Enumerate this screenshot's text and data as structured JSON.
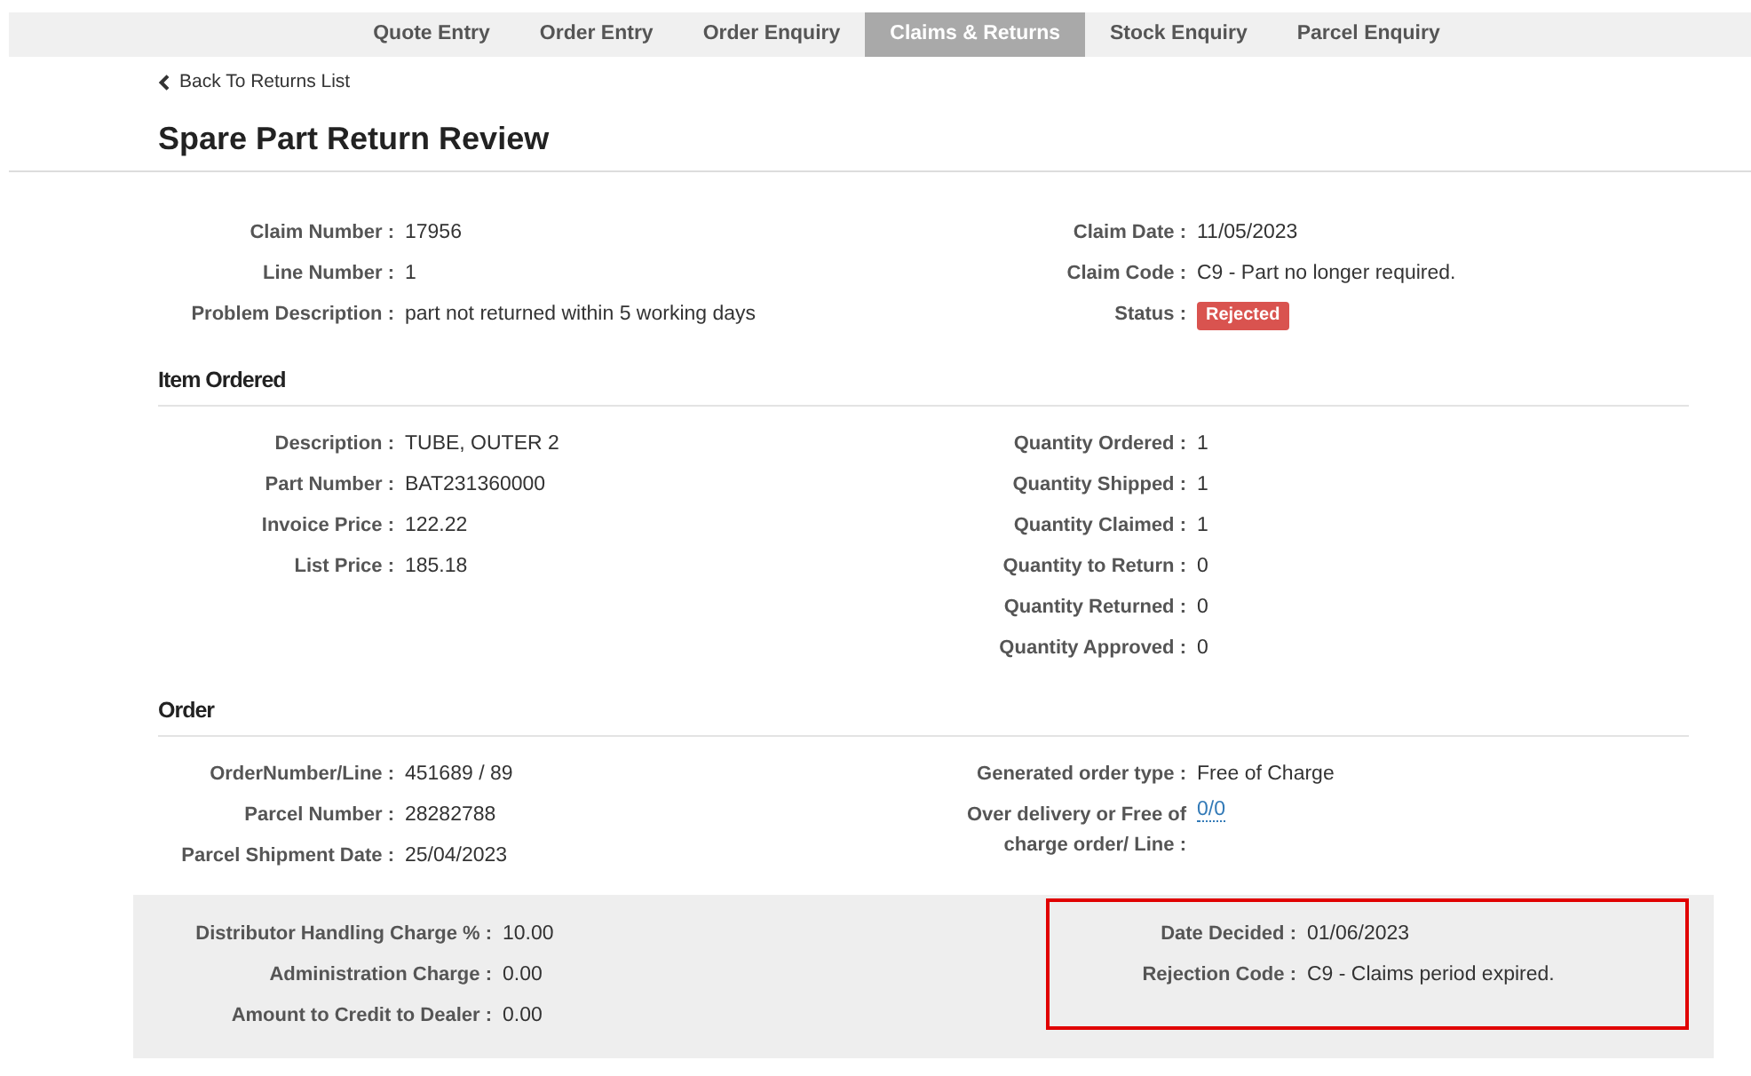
{
  "nav": {
    "tabs": [
      {
        "label": "Quote Entry",
        "selected": false
      },
      {
        "label": "Order Entry",
        "selected": false
      },
      {
        "label": "Order Enquiry",
        "selected": false
      },
      {
        "label": "Claims & Returns",
        "selected": true
      },
      {
        "label": "Stock Enquiry",
        "selected": false
      },
      {
        "label": "Parcel Enquiry",
        "selected": false
      }
    ]
  },
  "back_link": "Back To Returns List",
  "title": "Spare Part Return Review",
  "summary": {
    "left": [
      {
        "label": "Claim Number :",
        "value": "17956",
        "kind": "text"
      },
      {
        "label": "Line Number :",
        "value": "1",
        "kind": "text"
      },
      {
        "label": "Problem Description :",
        "value": "part not returned within 5 working days",
        "kind": "text"
      }
    ],
    "right": [
      {
        "label": "Claim Date :",
        "value": "11/05/2023",
        "kind": "text"
      },
      {
        "label": "Claim Code :",
        "value": "C9 - Part no longer required.",
        "kind": "text"
      },
      {
        "label": "Status :",
        "value": "Rejected",
        "kind": "badge",
        "color": "#d9534f"
      }
    ]
  },
  "sections": [
    {
      "title": "Item Ordered",
      "left": [
        {
          "label": "Description :",
          "value": "TUBE, OUTER 2",
          "kind": "text"
        },
        {
          "label": "Part Number :",
          "value": "BAT231360000",
          "kind": "text"
        },
        {
          "label": "Invoice Price :",
          "value": "122.22",
          "kind": "text"
        },
        {
          "label": "List Price :",
          "value": "185.18",
          "kind": "text"
        }
      ],
      "right": [
        {
          "label": "Quantity Ordered :",
          "value": "1",
          "kind": "text"
        },
        {
          "label": "Quantity Shipped :",
          "value": "1",
          "kind": "text"
        },
        {
          "label": "Quantity Claimed :",
          "value": "1",
          "kind": "text"
        },
        {
          "label": "Quantity to Return :",
          "value": "0",
          "kind": "text"
        },
        {
          "label": "Quantity Returned :",
          "value": "0",
          "kind": "text"
        },
        {
          "label": "Quantity Approved :",
          "value": "0",
          "kind": "text"
        }
      ]
    },
    {
      "title": "Order",
      "left": [
        {
          "label": "OrderNumber/Line :",
          "value": "451689 / 89",
          "kind": "text"
        },
        {
          "label": "Parcel Number :",
          "value": "28282788",
          "kind": "text"
        },
        {
          "label": "Parcel Shipment Date :",
          "value": "25/04/2023",
          "kind": "text"
        }
      ],
      "right": [
        {
          "label": "Generated order type :",
          "value": "Free of Charge",
          "kind": "text"
        },
        {
          "label": "Over delivery or Free of charge order/ Line :",
          "value": "0/0",
          "kind": "link"
        }
      ]
    }
  ],
  "footer": {
    "left": [
      {
        "label": "Distributor Handling Charge % :",
        "value": "10.00",
        "kind": "text"
      },
      {
        "label": "Administration Charge :",
        "value": "0.00",
        "kind": "text"
      },
      {
        "label": "Amount to Credit to Dealer :",
        "value": "0.00",
        "kind": "text"
      }
    ],
    "right": [
      {
        "label": "Date Decided :",
        "value": "01/06/2023",
        "kind": "text"
      },
      {
        "label": "Rejection Code :",
        "value": "C9 - Claims period expired.",
        "kind": "text"
      }
    ],
    "right_highlighted": true
  }
}
